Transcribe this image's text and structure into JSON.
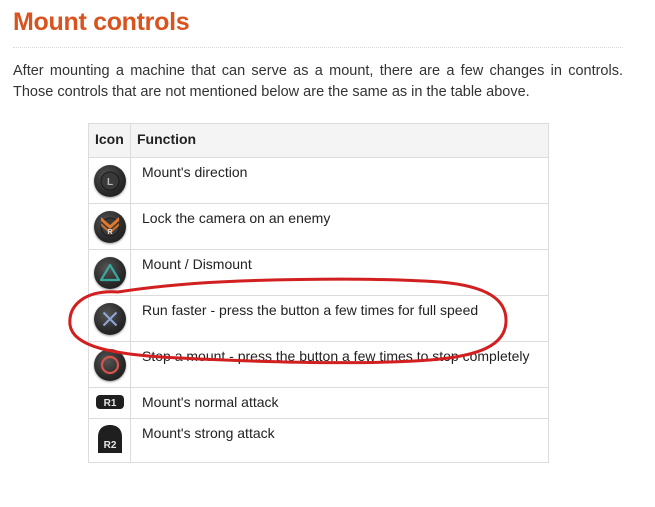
{
  "section": {
    "title": "Mount controls",
    "intro": "After mounting a machine that can serve as a mount, there are a few changes in controls. Those controls that are not mentioned below are the same as in the table above."
  },
  "table": {
    "headers": {
      "icon": "Icon",
      "function": "Function"
    },
    "rows": [
      {
        "icon": "l-stick-icon",
        "function": "Mount's direction"
      },
      {
        "icon": "r-stick-icon",
        "function": "Lock the camera on an enemy"
      },
      {
        "icon": "triangle-button-icon",
        "function": "Mount / Dismount"
      },
      {
        "icon": "cross-button-icon",
        "function": "Run faster - press the button a few times for full speed"
      },
      {
        "icon": "circle-button-icon",
        "function": "Stop a mount - press the button a few times to stop completely"
      },
      {
        "icon": "r1-button-icon",
        "icon_text": "R1",
        "function": "Mount's normal attack"
      },
      {
        "icon": "r2-button-icon",
        "icon_text": "R2",
        "function": "Mount's strong attack"
      }
    ]
  },
  "colors": {
    "title": "#d9531e",
    "annotation": "#d21f1f",
    "triangle": "#3aa89c",
    "cross": "#8fa6d6",
    "circle": "#d9534a",
    "r_stick": "#e2782a"
  }
}
